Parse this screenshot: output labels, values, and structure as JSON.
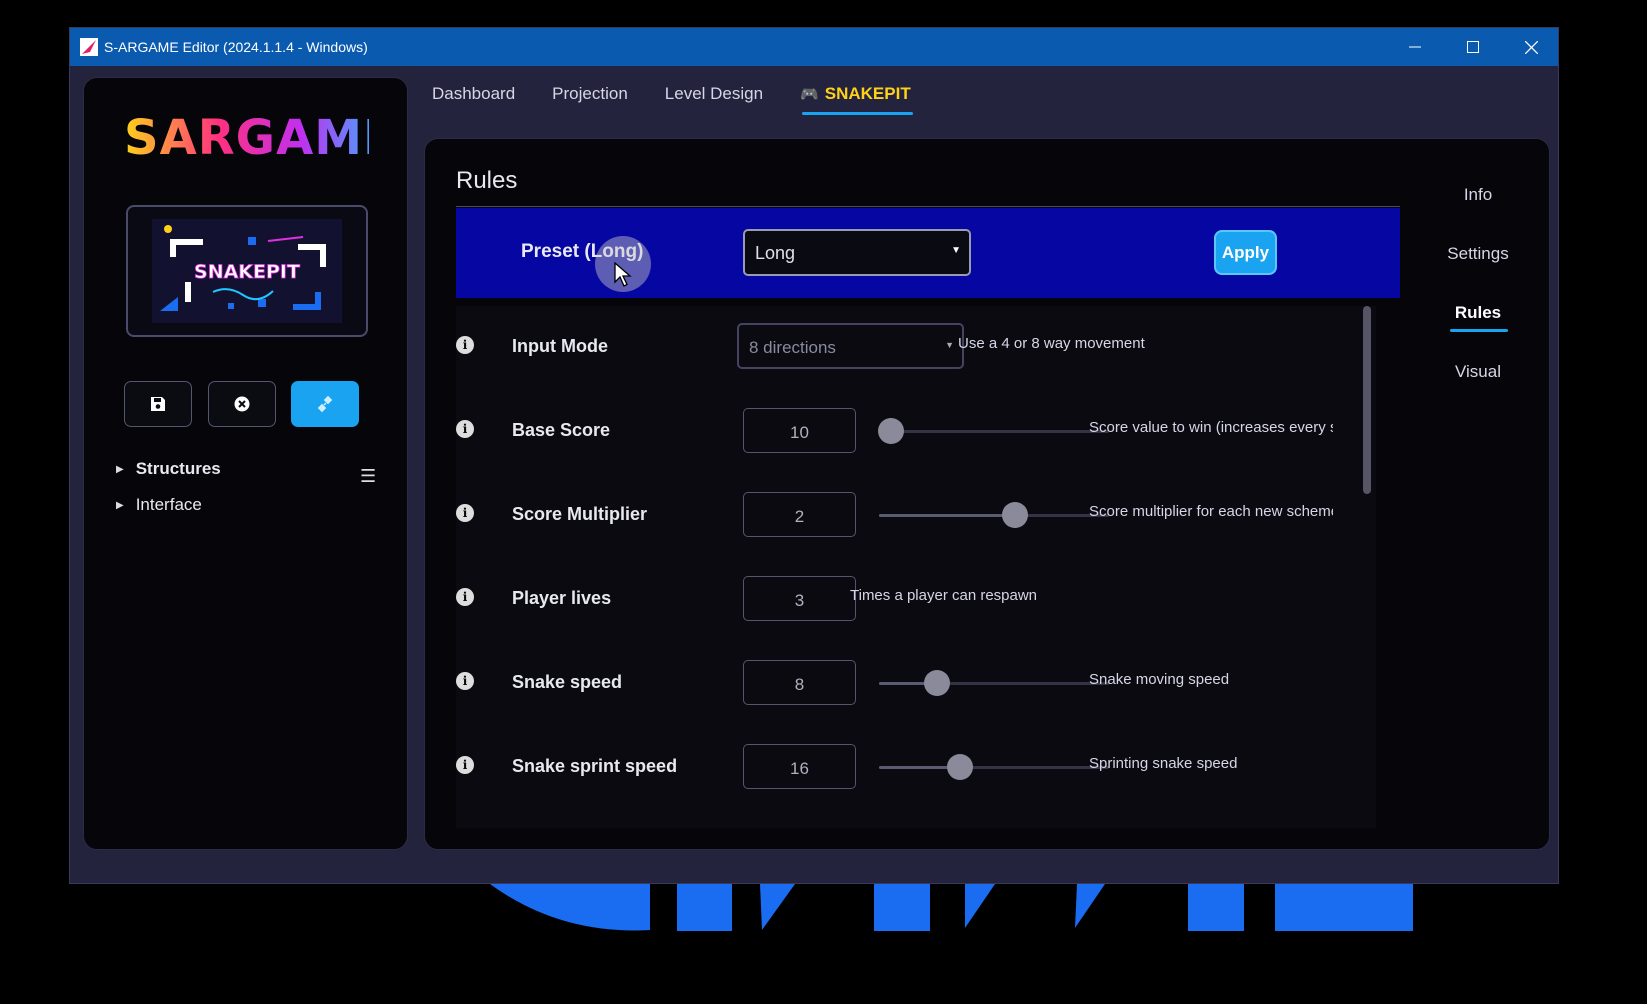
{
  "window": {
    "title": "S-ARGAME Editor (2024.1.1.4 - Windows)",
    "controls": [
      "minimize-icon",
      "maximize-icon",
      "close-icon"
    ]
  },
  "sidebar": {
    "logo_text": "SARGAME",
    "thumbnail_text": "SNAKEPIT",
    "tools": [
      {
        "name": "save-icon"
      },
      {
        "name": "close-circle-icon"
      },
      {
        "name": "unplug-icon",
        "active": true
      }
    ],
    "tree": [
      {
        "label": "Structures",
        "bold": true
      },
      {
        "label": "Interface",
        "bold": false
      }
    ]
  },
  "tabs": [
    "Dashboard",
    "Projection",
    "Level Design",
    "SNAKEPIT"
  ],
  "active_tab": "SNAKEPIT",
  "side_nav": [
    "Info",
    "Settings",
    "Rules",
    "Visual"
  ],
  "active_side_nav": "Rules",
  "rules": {
    "title": "Rules",
    "preset": {
      "label": "Preset (Long)",
      "value": "Long",
      "apply_label": "Apply"
    },
    "rows": [
      {
        "label": "Input Mode",
        "type": "dropdown",
        "value": "8 directions",
        "description": "Use a 4 or 8 way movement"
      },
      {
        "label": "Base Score",
        "type": "slider",
        "value": "10",
        "level": 0.05,
        "description": "Score value to win (increases every s"
      },
      {
        "label": "Score Multiplier",
        "type": "slider",
        "value": "2",
        "level": 0.59,
        "description": "Score multiplier for each new scheme"
      },
      {
        "label": "Player lives",
        "type": "number",
        "value": "3",
        "description": "Times a player can respawn"
      },
      {
        "label": "Snake speed",
        "type": "slider",
        "value": "8",
        "level": 0.25,
        "description": "Snake moving speed"
      },
      {
        "label": "Snake sprint speed",
        "type": "slider",
        "value": "16",
        "level": 0.35,
        "description": "Sprinting snake speed"
      }
    ]
  },
  "colors": {
    "accent": "#1aa3f0",
    "active_tab": "#ffd21a",
    "preset_bar": "#0606a2",
    "titlebar": "#0a5bb0"
  }
}
